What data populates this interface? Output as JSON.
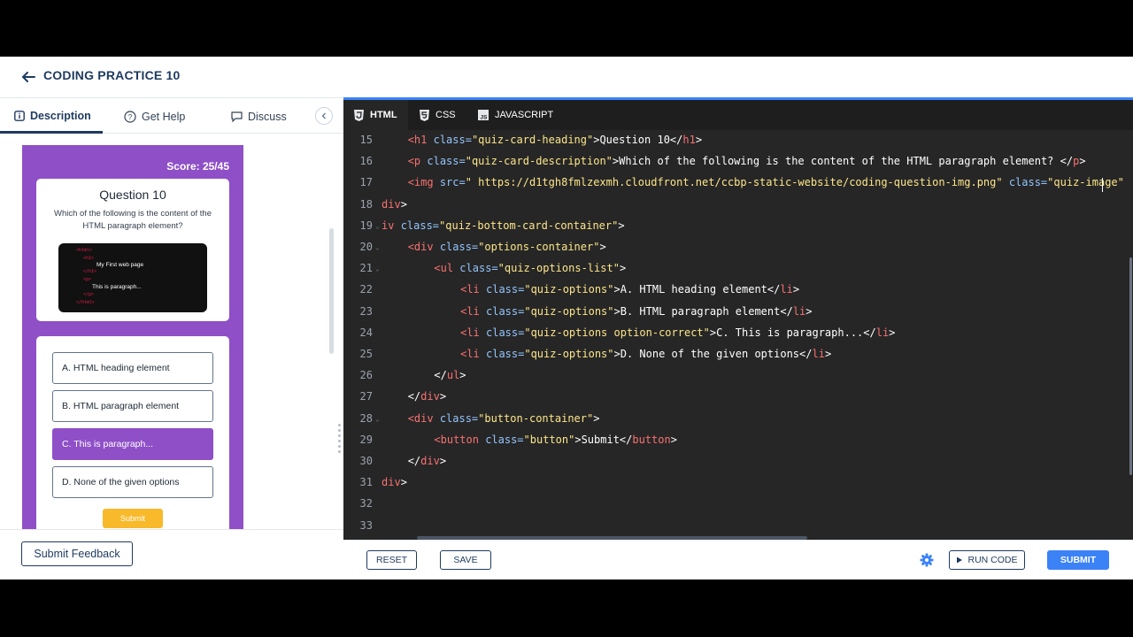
{
  "header": {
    "title": "CODING PRACTICE 10"
  },
  "left_tabs": {
    "description": "Description",
    "get_help": "Get Help",
    "discuss": "Discuss"
  },
  "preview": {
    "score": "Score: 25/45",
    "question_heading": "Question 10",
    "question_description": "Which of the following is the content of the HTML paragraph element?",
    "image": {
      "tags": [
        "<html>",
        "<h1>",
        "</h1>",
        "<p>",
        "</p>",
        "</html>"
      ],
      "heading_text": "My First web page",
      "paragraph_text": "This is paragraph..."
    },
    "options": [
      "A. HTML heading element",
      "B. HTML paragraph element",
      "C. This is paragraph...",
      "D. None of the given options"
    ],
    "submit_label": "Submit"
  },
  "footer_left": {
    "feedback_label": "Submit Feedback"
  },
  "editor_tabs": {
    "html": "HTML",
    "css": "CSS",
    "js": "JAVASCRIPT"
  },
  "code_lines": [
    {
      "n": "15",
      "fold": false,
      "indent": 1,
      "tokens": [
        [
          "t",
          "<h1 "
        ],
        [
          "a",
          "class="
        ],
        [
          "s",
          "\"quiz-card-heading\""
        ],
        [
          "x",
          ">Question 10</"
        ],
        [
          "t",
          "h1"
        ],
        [
          "x",
          ">"
        ]
      ]
    },
    {
      "n": "16",
      "fold": false,
      "indent": 1,
      "tokens": [
        [
          "t",
          "<p "
        ],
        [
          "a",
          "class="
        ],
        [
          "s",
          "\"quiz-card-description\""
        ],
        [
          "x",
          ">Which of the following is the content of the HTML paragraph element? </"
        ],
        [
          "t",
          "p"
        ],
        [
          "x",
          ">"
        ]
      ]
    },
    {
      "n": "17",
      "fold": false,
      "indent": 1,
      "tokens": [
        [
          "t",
          "<img "
        ],
        [
          "a",
          "src="
        ],
        [
          "s",
          "\" https://d1tgh8fmlzexmh.cloudfront.net/ccbp-static-website/coding-question-img.png\" "
        ],
        [
          "a",
          "class="
        ],
        [
          "s",
          "\"quiz-image\""
        ]
      ]
    },
    {
      "n": "18",
      "fold": false,
      "indent": 0,
      "tokens": [
        [
          "t",
          "div"
        ],
        [
          "x",
          ">"
        ]
      ]
    },
    {
      "n": "19",
      "fold": true,
      "indent": 0,
      "tokens": [
        [
          "t",
          "iv "
        ],
        [
          "a",
          "class="
        ],
        [
          "s",
          "\"quiz-bottom-card-container\""
        ],
        [
          "x",
          ">"
        ]
      ]
    },
    {
      "n": "20",
      "fold": true,
      "indent": 1,
      "tokens": [
        [
          "t",
          "<div "
        ],
        [
          "a",
          "class="
        ],
        [
          "s",
          "\"options-container\""
        ],
        [
          "x",
          ">"
        ]
      ]
    },
    {
      "n": "21",
      "fold": true,
      "indent": 2,
      "tokens": [
        [
          "t",
          "<ul "
        ],
        [
          "a",
          "class="
        ],
        [
          "s",
          "\"quiz-options-list\""
        ],
        [
          "x",
          ">"
        ]
      ]
    },
    {
      "n": "22",
      "fold": false,
      "indent": 3,
      "tokens": [
        [
          "t",
          "<li "
        ],
        [
          "a",
          "class="
        ],
        [
          "s",
          "\"quiz-options\""
        ],
        [
          "x",
          ">A. HTML heading element</"
        ],
        [
          "t",
          "li"
        ],
        [
          "x",
          ">"
        ]
      ]
    },
    {
      "n": "23",
      "fold": false,
      "indent": 3,
      "tokens": [
        [
          "t",
          "<li "
        ],
        [
          "a",
          "class="
        ],
        [
          "s",
          "\"quiz-options\""
        ],
        [
          "x",
          ">B. HTML paragraph element</"
        ],
        [
          "t",
          "li"
        ],
        [
          "x",
          ">"
        ]
      ]
    },
    {
      "n": "24",
      "fold": false,
      "indent": 3,
      "tokens": [
        [
          "t",
          "<li "
        ],
        [
          "a",
          "class="
        ],
        [
          "s",
          "\"quiz-options option-correct\""
        ],
        [
          "x",
          ">C. This is paragraph...</"
        ],
        [
          "t",
          "li"
        ],
        [
          "x",
          ">"
        ]
      ]
    },
    {
      "n": "25",
      "fold": false,
      "indent": 3,
      "tokens": [
        [
          "t",
          "<li "
        ],
        [
          "a",
          "class="
        ],
        [
          "s",
          "\"quiz-options\""
        ],
        [
          "x",
          ">D. None of the given options</"
        ],
        [
          "t",
          "li"
        ],
        [
          "x",
          ">"
        ]
      ]
    },
    {
      "n": "26",
      "fold": false,
      "indent": 2,
      "tokens": [
        [
          "x",
          "</"
        ],
        [
          "t",
          "ul"
        ],
        [
          "x",
          ">"
        ]
      ]
    },
    {
      "n": "27",
      "fold": false,
      "indent": 1,
      "tokens": [
        [
          "x",
          "</"
        ],
        [
          "t",
          "div"
        ],
        [
          "x",
          ">"
        ]
      ]
    },
    {
      "n": "28",
      "fold": true,
      "indent": 1,
      "tokens": [
        [
          "t",
          "<div "
        ],
        [
          "a",
          "class="
        ],
        [
          "s",
          "\"button-container\""
        ],
        [
          "x",
          ">"
        ]
      ]
    },
    {
      "n": "29",
      "fold": false,
      "indent": 2,
      "tokens": [
        [
          "t",
          "<button "
        ],
        [
          "a",
          "class="
        ],
        [
          "s",
          "\"button\""
        ],
        [
          "x",
          ">Submit</"
        ],
        [
          "t",
          "button"
        ],
        [
          "x",
          ">"
        ]
      ]
    },
    {
      "n": "30",
      "fold": false,
      "indent": 1,
      "tokens": [
        [
          "x",
          "</"
        ],
        [
          "t",
          "div"
        ],
        [
          "x",
          ">"
        ]
      ]
    },
    {
      "n": "31",
      "fold": false,
      "indent": 0,
      "tokens": [
        [
          "t",
          "div"
        ],
        [
          "x",
          ">"
        ]
      ]
    },
    {
      "n": "32",
      "fold": false,
      "indent": 0,
      "tokens": []
    },
    {
      "n": "33",
      "fold": false,
      "indent": 0,
      "tokens": []
    }
  ],
  "footer_right": {
    "reset": "RESET",
    "save": "SAVE",
    "run": "RUN CODE",
    "submit": "SUBMIT"
  },
  "colors": {
    "brand": "#1e3a5f",
    "accent": "#3b82f6",
    "quiz_purple": "#8e4fc7",
    "quiz_submit": "#f8b92b",
    "editor_bg": "#262626"
  },
  "icons": [
    "back-arrow-icon",
    "info-circle-icon",
    "help-circle-icon",
    "chat-icon",
    "chevron-left-icon",
    "html5-icon",
    "css3-icon",
    "javascript-icon",
    "gear-icon",
    "play-icon"
  ]
}
